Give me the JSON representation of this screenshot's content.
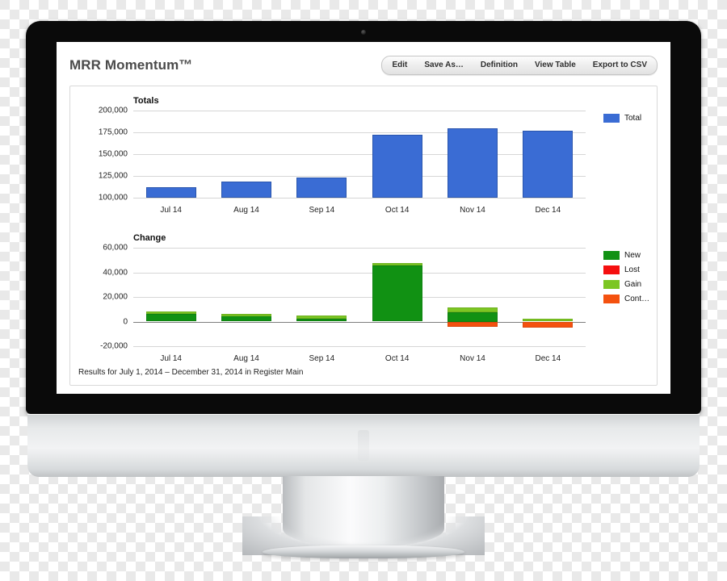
{
  "app": {
    "title": "MRR Momentum™",
    "footer_note": "Results for July 1, 2014 – December 31, 2014 in Register Main"
  },
  "toolbar": {
    "buttons": [
      {
        "label": "Edit"
      },
      {
        "label": "Save As…"
      },
      {
        "label": "Definition"
      },
      {
        "label": "View Table"
      },
      {
        "label": "Export to CSV"
      }
    ]
  },
  "colors": {
    "total_blue": "#3a6cd4",
    "new_green": "#119113",
    "lost_red": "#f50f0f",
    "gain_light_green": "#7cc623",
    "cont_orange": "#f4510f",
    "grid": "#d6d6d6",
    "axis": "#7d7d7d"
  },
  "chart_data": [
    {
      "type": "bar",
      "title": "Totals",
      "xlabel": "",
      "ylabel": "",
      "categories": [
        "Jul 14",
        "Aug 14",
        "Sep 14",
        "Oct 14",
        "Nov 14",
        "Dec 14"
      ],
      "yticks": [
        "100,000",
        "125,000",
        "150,000",
        "175,000",
        "200,000"
      ],
      "ytick_values": [
        100000,
        125000,
        150000,
        175000,
        200000
      ],
      "ylim": [
        100000,
        200000
      ],
      "grid": true,
      "legend_position": "right",
      "series": [
        {
          "name": "Total",
          "color": "#3a6cd4",
          "values": [
            112000,
            118500,
            123500,
            172000,
            179500,
            177000
          ]
        }
      ]
    },
    {
      "type": "bar",
      "title": "Change",
      "xlabel": "",
      "ylabel": "",
      "categories": [
        "Jul 14",
        "Aug 14",
        "Sep 14",
        "Oct 14",
        "Nov 14",
        "Dec 14"
      ],
      "yticks": [
        "-20,000",
        "0",
        "20,000",
        "40,000",
        "60,000"
      ],
      "ytick_values": [
        -20000,
        0,
        20000,
        40000,
        60000
      ],
      "ylim": [
        -20000,
        60000
      ],
      "grid": true,
      "stacked": true,
      "legend_position": "right",
      "series": [
        {
          "name": "New",
          "color": "#119113",
          "values": [
            6000,
            6200,
            2000,
            45500,
            7500,
            0
          ]
        },
        {
          "name": "Lost",
          "color": "#f50f0f",
          "values": [
            0,
            0,
            0,
            0,
            0,
            0
          ]
        },
        {
          "name": "Gain",
          "color": "#7cc623",
          "values": [
            2200,
            200,
            2800,
            1800,
            4000,
            2000
          ]
        },
        {
          "name": "Cont…",
          "color": "#f4510f",
          "values": [
            0,
            0,
            0,
            0,
            -4200,
            -5200
          ]
        }
      ]
    }
  ]
}
